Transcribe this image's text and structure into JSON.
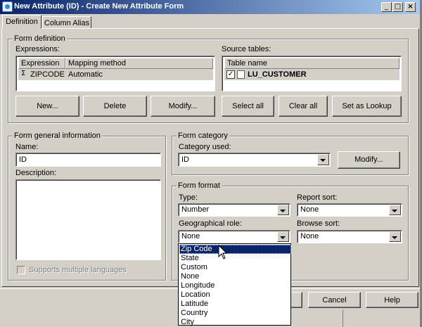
{
  "window": {
    "title": "New Attribute (ID) - Create New Attribute Form",
    "controls": [
      "_",
      "□",
      "×"
    ]
  },
  "tabs": [
    {
      "label": "Definition",
      "active": true
    },
    {
      "label": "Column Alias",
      "active": false
    }
  ],
  "form_definition": {
    "legend": "Form definition",
    "expressions_label": "Expressions:",
    "expressions_headers": [
      "Expression",
      "Mapping method"
    ],
    "expressions_rows": [
      {
        "icon": "Σ",
        "expression": "ZIPCODE",
        "mapping": "Automatic"
      }
    ],
    "source_tables_label": "Source tables:",
    "source_tables_header": "Table name",
    "source_tables_rows": [
      {
        "name": "LU_CUSTOMER",
        "checked": true
      }
    ],
    "buttons": {
      "new": "New...",
      "delete": "Delete",
      "modify": "Modify...",
      "select_all": "Select all",
      "clear_all": "Clear all",
      "set_as_lookup": "Set as Lookup"
    }
  },
  "general_info": {
    "legend": "Form general information",
    "name_label": "Name:",
    "name_value": "ID",
    "description_label": "Description:",
    "description_value": "",
    "multi_lang_label": "Supports multiple languages"
  },
  "category": {
    "legend": "Form category",
    "category_used_label": "Category used:",
    "category_value": "ID",
    "modify_button": "Modify..."
  },
  "format": {
    "legend": "Form format",
    "type_label": "Type:",
    "type_value": "Number",
    "report_sort_label": "Report sort:",
    "report_sort_value": "None",
    "geo_role_label": "Geographical role:",
    "geo_role_value": "None",
    "browse_sort_label": "Browse sort:",
    "browse_sort_value": "None"
  },
  "geo_dropdown": {
    "options": [
      "Zip Code",
      "State",
      "Custom",
      "None",
      "Longitude",
      "Location",
      "Latitude",
      "Country",
      "City"
    ],
    "highlighted": "Zip Code"
  },
  "footer": {
    "cancel": "Cancel",
    "help": "Help"
  }
}
